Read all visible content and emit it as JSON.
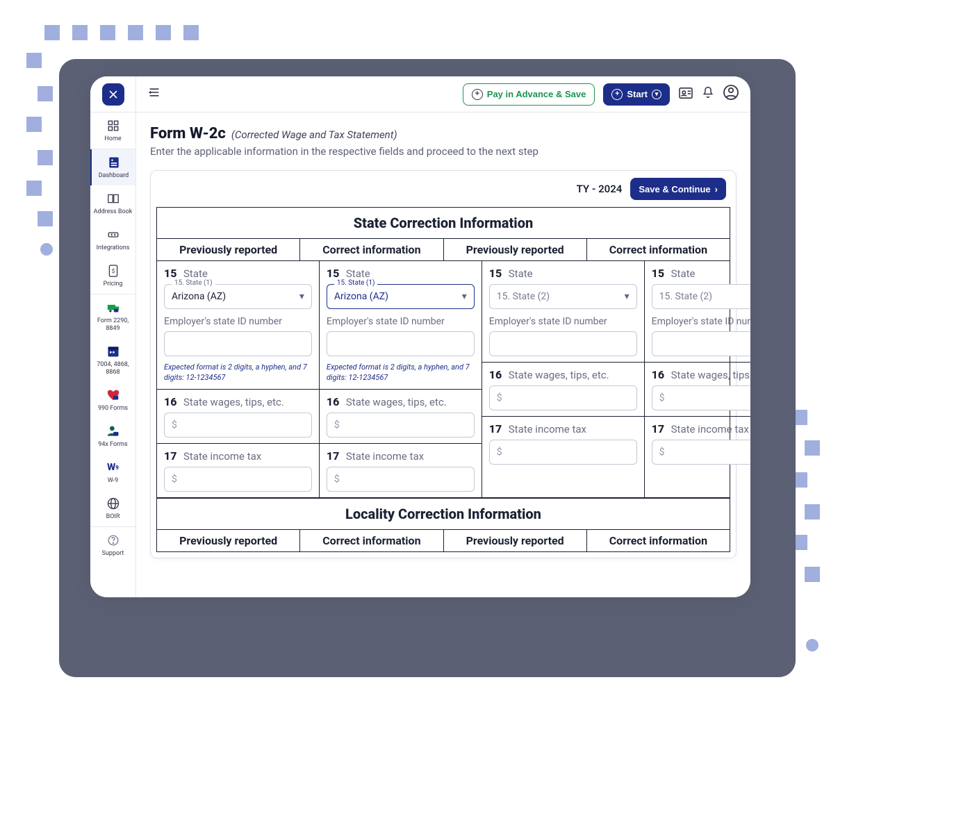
{
  "topbar": {
    "pay_advance_label": "Pay in Advance & Save",
    "start_label": "Start"
  },
  "sidebar": {
    "items": [
      {
        "label": "Home"
      },
      {
        "label": "Dashboard"
      },
      {
        "label": "Address Book"
      },
      {
        "label": "Integrations"
      },
      {
        "label": "Pricing"
      },
      {
        "label": "Form 2290, 8849"
      },
      {
        "label": "7004, 4868, 8868"
      },
      {
        "label": "990 Forms"
      },
      {
        "label": "94x Forms"
      },
      {
        "label": "W-9"
      },
      {
        "label": "BOIR"
      },
      {
        "label": "Support"
      }
    ]
  },
  "page": {
    "title": "Form W-2c",
    "subtitle": "(Corrected Wage and Tax Statement)",
    "description": "Enter the applicable information in the respective fields and proceed to the next step"
  },
  "card": {
    "ty_label": "TY - 2024",
    "save_label": "Save & Continue"
  },
  "form": {
    "state_section_title": "State Correction Information",
    "locality_section_title": "Locality Correction Information",
    "col_headers": {
      "prev": "Previously reported",
      "corr": "Correct information"
    },
    "box15_num": "15",
    "box15_label": "State",
    "box16_num": "16",
    "box16_label": "State wages, tips, etc.",
    "box17_num": "17",
    "box17_label": "State income tax",
    "state1_float": "15. State (1)",
    "state2_placeholder": "15. State (2)",
    "state1_prev_value": "Arizona (AZ)",
    "state1_corr_value": "Arizona (AZ)",
    "ein_label": "Employer's state ID number",
    "ein_hint": "Expected format is 2 digits, a hyphen, and 7 digits: 12-1234567",
    "dollar": "$"
  }
}
